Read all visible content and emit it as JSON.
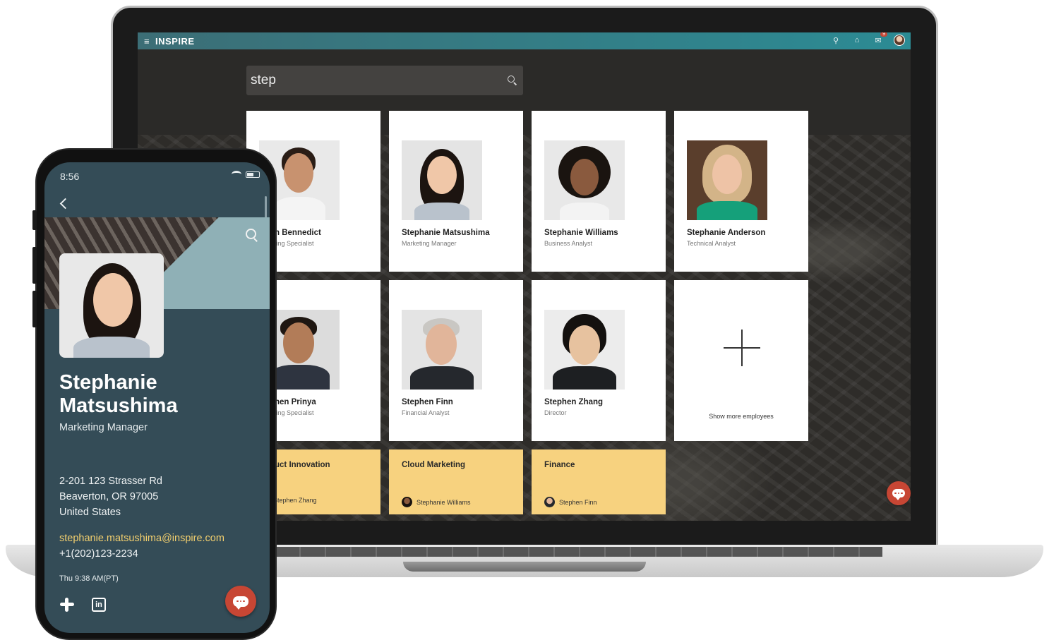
{
  "laptop": {
    "app": {
      "menu_icon": "hamburger-icon",
      "brand": "INSPIRE",
      "notification_count": "9",
      "search_value": "step"
    },
    "employees": [
      {
        "name": "Stephen Bennedict",
        "visible_name": "h Bennedict",
        "role": "Marketing Specialist",
        "visible_role": "ting Specialist"
      },
      {
        "name": "Stephanie Matsushima",
        "visible_name": "Stephanie Matsushima",
        "role": "Marketing Manager",
        "visible_role": "Marketing Manager"
      },
      {
        "name": "Stephanie Williams",
        "visible_name": "Stephanie Williams",
        "role": "Business Analyst",
        "visible_role": "Business Analyst"
      },
      {
        "name": "Stephanie Anderson",
        "visible_name": "Stephanie Anderson",
        "role": "Technical Analyst",
        "visible_role": "Technical Analyst"
      },
      {
        "name": "Stephen Prinya",
        "visible_name": "hen Prinya",
        "role": "Marketing Specialist",
        "visible_role": "ting Specialist"
      },
      {
        "name": "Stephen Finn",
        "visible_name": "Stephen Finn",
        "role": "Financial Analyst",
        "visible_role": "Financial Analyst"
      },
      {
        "name": "Stephen Zhang",
        "visible_name": "Stephen Zhang",
        "role": "Director",
        "visible_role": "Director"
      }
    ],
    "show_more_label": "Show more employees",
    "teams": [
      {
        "visible_name": "uct Innovation",
        "visible_owner": "Stephen Zhang"
      },
      {
        "visible_name": "Cloud Marketing",
        "visible_owner": "Stephanie Williams"
      },
      {
        "visible_name": "Finance",
        "visible_owner": "Stephen Finn"
      }
    ]
  },
  "phone": {
    "status_time": "8:56",
    "name": "Stephanie Matsushima",
    "title": "Marketing Manager",
    "address_line1": "2-201 123 Strasser Rd",
    "address_line2": "Beaverton, OR 97005",
    "address_line3": "United States",
    "email": "stephanie.matsushima@inspire.com",
    "phone": "+1(202)123-2234",
    "local_time": "Thu 9:38 AM(PT)"
  },
  "colors": {
    "brand_bar": "#2c8b94",
    "team_card": "#f7d27f",
    "chat_fab": "#c74634",
    "phone_bg": "#344c57",
    "email_link": "#f2cf6e"
  }
}
